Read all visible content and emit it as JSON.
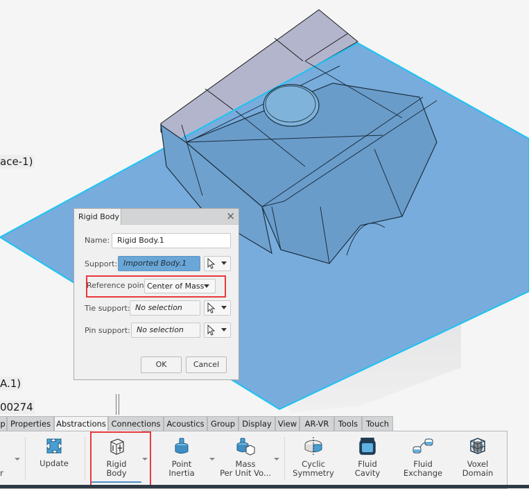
{
  "viewport": {
    "tree_labels": [
      "ace-1)",
      "A.1)",
      "00274"
    ],
    "colors": {
      "plane_fill": "#78acdc",
      "plane_edge": "#19c4f4",
      "body_top": "#b3b5cd",
      "body_side": "#6a9cca",
      "edge_lines": "#1a2f3f"
    }
  },
  "dialog": {
    "title": "Rigid Body",
    "close_icon": "close-icon",
    "fields": {
      "name": {
        "label": "Name:",
        "value": "Rigid Body.1"
      },
      "support": {
        "label": "Support:",
        "value": "Imported Body.1"
      },
      "reference_point": {
        "label": "Reference point:",
        "value": "Center of Mass"
      },
      "tie_support": {
        "label": "Tie support:",
        "value": "No selection"
      },
      "pin_support": {
        "label": "Pin support:",
        "value": "No selection"
      }
    },
    "buttons": {
      "ok": "OK",
      "cancel": "Cancel"
    }
  },
  "ribbon": {
    "tabs": [
      {
        "label": "p"
      },
      {
        "label": "Properties"
      },
      {
        "label": "Abstractions",
        "active": true
      },
      {
        "label": "Connections"
      },
      {
        "label": "Acoustics"
      },
      {
        "label": "Group"
      },
      {
        "label": "Display"
      },
      {
        "label": "View"
      },
      {
        "label": "AR-VR"
      },
      {
        "label": "Tools"
      },
      {
        "label": "Touch"
      }
    ],
    "tools": [
      {
        "label1": "",
        "label2": "r",
        "icon": "truncated-tool"
      },
      {
        "label1": "Update",
        "label2": "",
        "icon": "update-icon"
      },
      {
        "label1": "Rigid",
        "label2": "Body",
        "icon": "rigid-body-icon"
      },
      {
        "label1": "Point",
        "label2": "Inertia",
        "icon": "point-inertia-icon"
      },
      {
        "label1": "Mass",
        "label2": "Per Unit Vo...",
        "icon": "mass-per-unit-volume-icon"
      },
      {
        "label1": "Cyclic",
        "label2": "Symmetry",
        "icon": "cyclic-symmetry-icon"
      },
      {
        "label1": "Fluid",
        "label2": "Cavity",
        "icon": "fluid-cavity-icon"
      },
      {
        "label1": "Fluid",
        "label2": "Exchange",
        "icon": "fluid-exchange-icon"
      },
      {
        "label1": "Voxel",
        "label2": "Domain",
        "icon": "voxel-domain-icon"
      }
    ]
  },
  "annotations": {
    "highlight_color": "#e8383d"
  }
}
